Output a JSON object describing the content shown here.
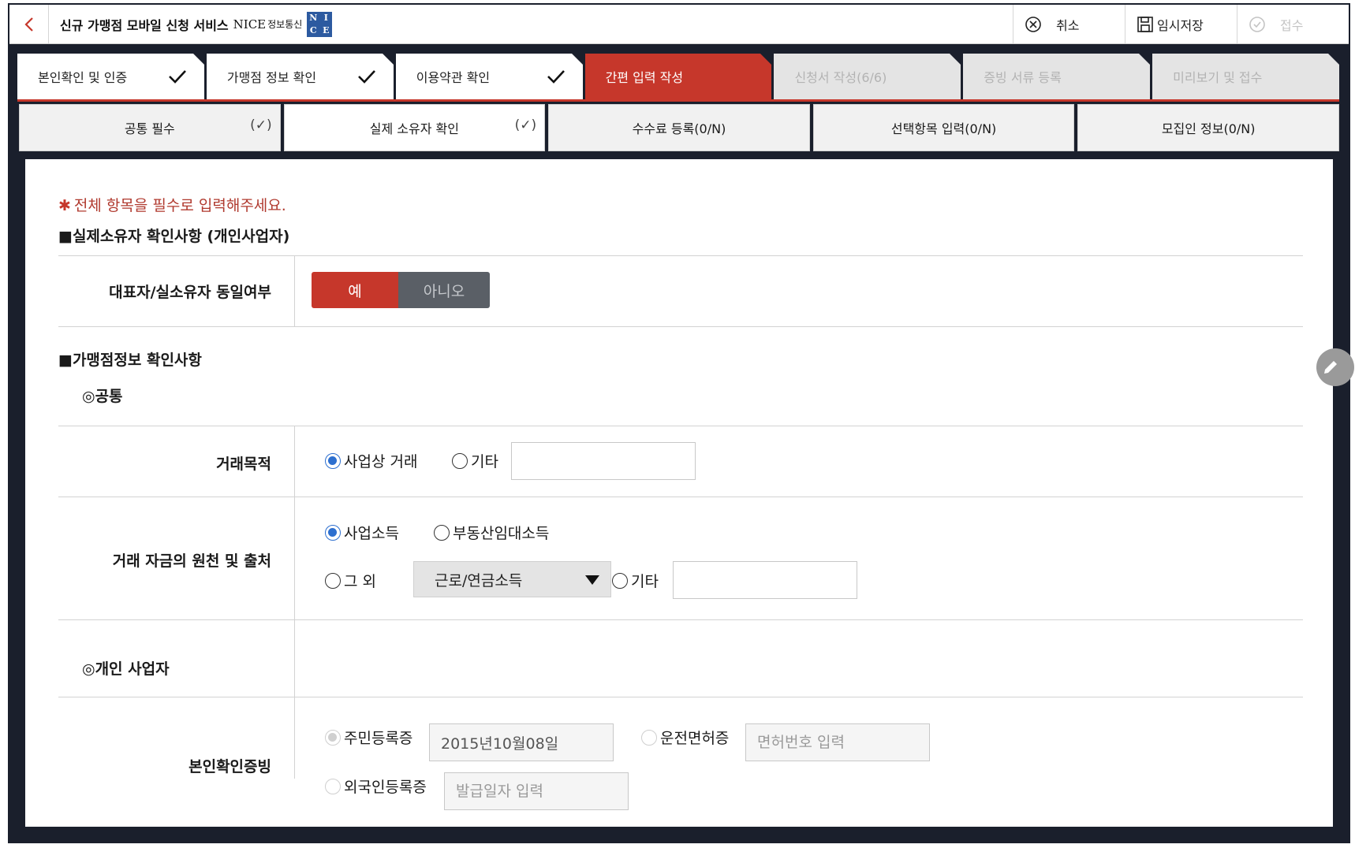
{
  "header": {
    "title": "신규 가맹점 모바일 신청 서비스",
    "brand": "NICE",
    "brand_sub": "정보통신",
    "logo_letters": [
      "N",
      "I",
      "C",
      "E"
    ],
    "actions": {
      "cancel": "취소",
      "temp_save": "임시저장",
      "submit": "접수"
    }
  },
  "steps": [
    {
      "label": "본인확인 및 인증",
      "status": "done"
    },
    {
      "label": "가맹점 정보 확인",
      "status": "done"
    },
    {
      "label": "이용약관 확인",
      "status": "done"
    },
    {
      "label": "간편 입력 작성",
      "status": "active"
    },
    {
      "label": "신청서 작성(6/6)",
      "status": "future"
    },
    {
      "label": "증빙 서류 등록",
      "status": "future"
    },
    {
      "label": "미리보기 및 접수",
      "status": "future"
    }
  ],
  "subtabs": [
    {
      "label": "공통 필수",
      "mark": "(✓)"
    },
    {
      "label": "실제 소유자 확인",
      "mark": "(✓)"
    },
    {
      "label": "수수료 등록(0/N)",
      "mark": ""
    },
    {
      "label": "선택항목 입력(0/N)",
      "mark": ""
    },
    {
      "label": "모집인 정보(0/N)",
      "mark": ""
    }
  ],
  "form": {
    "notice_star": "✱",
    "notice": "전체 항목을 필수로 입력해주세요.",
    "owner_section": "■실제소유자 확인사항 (개인사업자)",
    "owner_same_label": "대표자/실소유자 동일여부",
    "owner_same_yes": "예",
    "owner_same_no": "아니오",
    "owner_same_value": "예",
    "merchant_section": "■가맹점정보 확인사항",
    "common_sub": "◎공통",
    "purpose_label": "거래목적",
    "purpose_options": [
      "사업상 거래",
      "기타"
    ],
    "purpose_selected": "사업상 거래",
    "purpose_other_value": "",
    "funds_label": "거래 자금의 원천 및 출처",
    "funds_options": [
      "사업소득",
      "부동산임대소득",
      "그 외",
      "기타"
    ],
    "funds_selected": "사업소득",
    "funds_other_select": "근로/연금소득",
    "funds_other_value": "",
    "individual_sub": "◎개인 사업자",
    "id_label": "본인확인증빙",
    "id_options": [
      "주민등록증",
      "운전면허증",
      "외국인등록증"
    ],
    "id_selected": "주민등록증",
    "id_resident_value": "2015년10월08일",
    "id_license_placeholder": "면허번호 입력",
    "id_foreign_placeholder": "발급일자 입력"
  },
  "colors": {
    "accent": "#c6372b",
    "frame": "#1a1f2c",
    "radio": "#2d6fcf"
  }
}
